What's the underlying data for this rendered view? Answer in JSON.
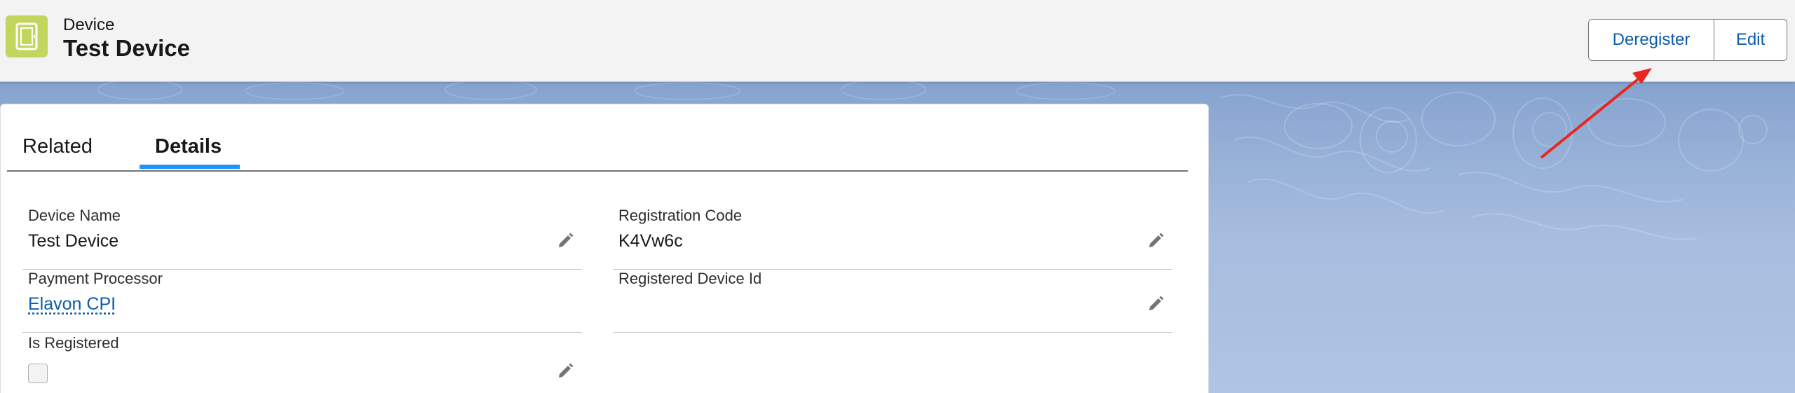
{
  "header": {
    "object_type": "Device",
    "record_title": "Test Device",
    "icon": "tablet-device-icon",
    "icon_color": "#c2d65e",
    "actions": {
      "deregister_label": "Deregister",
      "edit_label": "Edit"
    }
  },
  "tabs": [
    {
      "label": "Related",
      "active": false
    },
    {
      "label": "Details",
      "active": true
    }
  ],
  "fields": {
    "device_name": {
      "label": "Device Name",
      "value": "Test Device"
    },
    "registration_code": {
      "label": "Registration Code",
      "value": "K4Vw6c"
    },
    "payment_processor": {
      "label": "Payment Processor",
      "value": "Elavon CPI"
    },
    "registered_device_id": {
      "label": "Registered Device Id",
      "value": ""
    },
    "is_registered": {
      "label": "Is Registered",
      "checked": false
    }
  },
  "colors": {
    "accent": "#0b5cab",
    "tab_indicator": "#1b96ff",
    "annotation_arrow": "#e8271f"
  }
}
